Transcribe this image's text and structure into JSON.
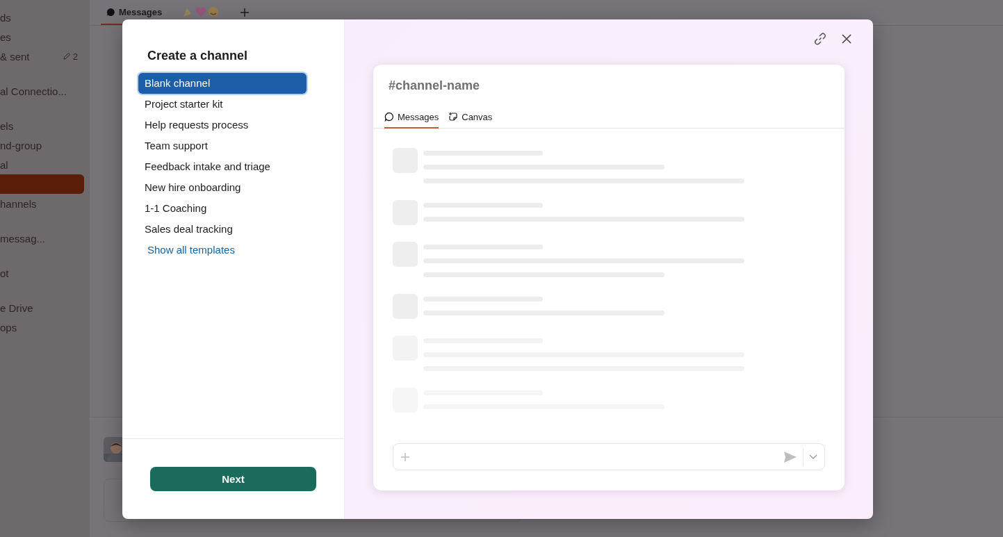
{
  "sidebar": {
    "sections": [
      {
        "items": [
          {
            "label": "ds",
            "selected": false
          },
          {
            "label": "es",
            "selected": false
          },
          {
            "label": "& sent",
            "badge": "2",
            "selected": false
          }
        ]
      },
      {
        "items": [
          {
            "label": "al Connectio...",
            "selected": false
          }
        ]
      },
      {
        "items": [
          {
            "label": "els",
            "selected": false
          },
          {
            "label": "nd-group",
            "selected": false
          },
          {
            "label": "al",
            "selected": false
          },
          {
            "selected": true
          },
          {
            "label": "hannels",
            "selected": false
          }
        ]
      },
      {
        "items": [
          {
            "label": "messag...",
            "selected": false
          }
        ]
      },
      {
        "items": [
          {
            "label": "ot",
            "selected": false
          }
        ]
      },
      {
        "items": [
          {
            "label": "e Drive",
            "selected": false
          },
          {
            "label": "ops",
            "selected": false
          }
        ]
      }
    ]
  },
  "tabs": [
    {
      "kind": "text",
      "label": "Messages",
      "selected": true
    },
    {
      "kind": "emoji",
      "selected": false
    }
  ],
  "dialog": {
    "title": "Create a channel",
    "templates": [
      {
        "label": "Blank channel",
        "selected": true
      },
      {
        "label": "Project starter kit",
        "selected": false
      },
      {
        "label": "Help requests process",
        "selected": false
      },
      {
        "label": "Team support",
        "selected": false
      },
      {
        "label": "Feedback intake and triage",
        "selected": false
      },
      {
        "label": "New hire onboarding",
        "selected": false
      },
      {
        "label": "1-1 Coaching",
        "selected": false
      },
      {
        "label": "Sales deal tracking",
        "selected": false
      }
    ],
    "show_all_link": "Show all templates",
    "next_button": "Next",
    "preview": {
      "channel_name": "#channel-name",
      "tabs": [
        {
          "label": "Messages",
          "kind": "messages",
          "selected": true
        },
        {
          "label": "Canvas",
          "kind": "canvas",
          "selected": false
        }
      ]
    }
  }
}
